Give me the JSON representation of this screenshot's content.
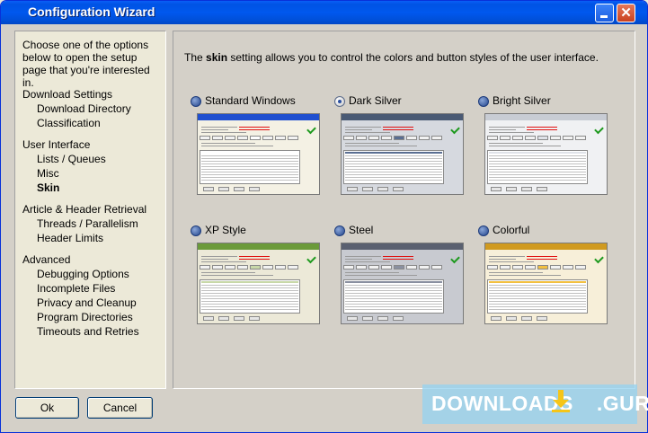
{
  "window": {
    "title": "Configuration Wizard"
  },
  "sidebar": {
    "intro": "Choose one of the options below to open the setup page that you're interested in.",
    "sections": [
      {
        "label": "Download Settings",
        "items": [
          "Download Directory",
          "Classification"
        ]
      },
      {
        "label": "User Interface",
        "items": [
          "Lists / Queues",
          "Misc",
          "Skin"
        ]
      },
      {
        "label": "Article & Header Retrieval",
        "items": [
          "Threads / Parallelism",
          "Header Limits"
        ]
      },
      {
        "label": "Advanced",
        "items": [
          "Debugging Options",
          "Incomplete Files",
          "Privacy and Cleanup",
          "Program Directories",
          "Timeouts and Retries"
        ]
      }
    ],
    "active_item": "Skin"
  },
  "main": {
    "desc_prefix": "The ",
    "desc_bold": "skin",
    "desc_suffix": " setting allows you to control the colors and button styles of the user interface.",
    "skins": [
      {
        "label": "Standard Windows",
        "selected": false,
        "title_color": "#1f4fd0",
        "bg_color": "#f4f1e4",
        "tab_color": "#ffffff"
      },
      {
        "label": "Dark Silver",
        "selected": true,
        "title_color": "#4a5a74",
        "bg_color": "#d6d9df",
        "tab_color": "#5a6e92"
      },
      {
        "label": "Bright Silver",
        "selected": false,
        "title_color": "#c8ccd4",
        "bg_color": "#f0f1f3",
        "tab_color": "#dfe2e8"
      },
      {
        "label": "XP Style",
        "selected": false,
        "title_color": "#6b9a3a",
        "bg_color": "#ece9d8",
        "tab_color": "#c8d8a8"
      },
      {
        "label": "Steel",
        "selected": false,
        "title_color": "#5a6070",
        "bg_color": "#c8cad0",
        "tab_color": "#8a90a0"
      },
      {
        "label": "Colorful",
        "selected": false,
        "title_color": "#d09a20",
        "bg_color": "#f7efd9",
        "tab_color": "#f2c040"
      }
    ]
  },
  "footer": {
    "ok_label": "Ok",
    "cancel_label": "Cancel"
  },
  "watermark": {
    "text_left": "DOWNLOADS",
    "text_right": ".GURU",
    "icon": "download-arrow-icon"
  },
  "colors": {
    "titlebar": "#0058ee",
    "panel_bg": "#ece9d8",
    "window_bg": "#d4d0c8"
  }
}
